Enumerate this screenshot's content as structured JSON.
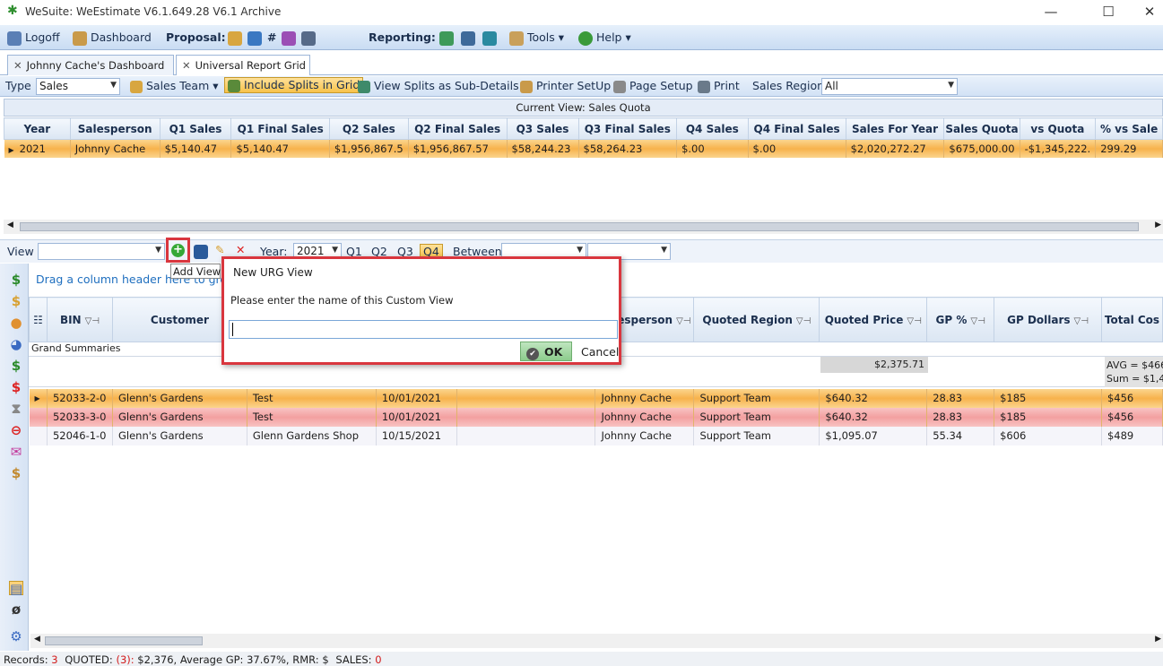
{
  "window": {
    "title": "WeSuite: WeEstimate V6.1.649.28 V6.1 Archive"
  },
  "menu": {
    "logoff": "Logoff",
    "dashboard": "Dashboard",
    "proposal": "Proposal:",
    "reporting": "Reporting:",
    "tools": "Tools",
    "help": "Help"
  },
  "tabs": [
    {
      "label": "Johnny Cache's Dashboard"
    },
    {
      "label": "Universal Report Grid"
    }
  ],
  "toolbar": {
    "type_label": "Type",
    "type_value": "Sales",
    "sales_team": "Sales Team",
    "include_splits": "Include Splits in Grid",
    "view_splits": "View Splits as Sub-Details",
    "printer_setup": "Printer SetUp",
    "page_setup": "Page Setup",
    "print": "Print",
    "sales_region_label": "Sales Region",
    "sales_region_value": "All"
  },
  "current_view": "Current View: Sales Quota",
  "quota_grid": {
    "columns": [
      "Year",
      "Salesperson",
      "Q1 Sales",
      "Q1 Final Sales",
      "Q2 Sales",
      "Q2 Final Sales",
      "Q3 Sales",
      "Q3 Final Sales",
      "Q4 Sales",
      "Q4 Final Sales",
      "Sales For Year",
      "Sales Quota",
      "vs Quota",
      "% vs Sale"
    ],
    "rows": [
      [
        "2021",
        "Johnny Cache",
        "$5,140.47",
        "$5,140.47",
        "$1,956,867.5",
        "$1,956,867.57",
        "$58,244.23",
        "$58,264.23",
        "$.00",
        "$.00",
        "$2,020,272.27",
        "$675,000.00",
        "-$1,345,222.",
        "299.29"
      ]
    ]
  },
  "viewbar": {
    "view_label": "View",
    "year_label": "Year:",
    "year_value": "2021",
    "quarters": [
      "Q1",
      "Q2",
      "Q3",
      "Q4"
    ],
    "between_label": "Between"
  },
  "tooltip": "Add View",
  "drag_hint": "Drag a column header here to group",
  "detail_grid": {
    "columns": [
      "BIN",
      "Customer",
      "",
      "",
      "",
      "Salesperson",
      "Quoted Region",
      "Quoted Price",
      "GP %",
      "GP Dollars",
      "Total Cos"
    ],
    "grand_summaries": "Grand Summaries",
    "summary_quoted_price": "$2,375.71",
    "summary_avg": "AVG = $466.",
    "summary_sum": "Sum = $1,40",
    "rows": [
      [
        "52033-2-0",
        "Glenn's Gardens",
        "Test",
        "10/01/2021",
        "",
        "Johnny Cache",
        "Support Team",
        "$640.32",
        "28.83",
        "$185",
        "$456"
      ],
      [
        "52033-3-0",
        "Glenn's Gardens",
        "Test",
        "10/01/2021",
        "",
        "Johnny Cache",
        "Support Team",
        "$640.32",
        "28.83",
        "$185",
        "$456"
      ],
      [
        "52046-1-0",
        "Glenn's Gardens",
        "Glenn Gardens Shop",
        "10/15/2021",
        "",
        "Johnny Cache",
        "Support Team",
        "$1,095.07",
        "55.34",
        "$606",
        "$489"
      ]
    ]
  },
  "dialog": {
    "title": "New URG View",
    "message": "Please enter the name of this Custom View",
    "input_value": "",
    "ok": "OK",
    "cancel": "Cancel"
  },
  "status": {
    "records_label": "Records:",
    "records_count": "3",
    "quoted_label": "QUOTED:",
    "quoted_count": "(3):",
    "quoted_text": "$2,376, Average GP: 37.67%, RMR: $",
    "sales_label": "SALES:",
    "sales_count": "0"
  },
  "colors": {
    "accent_red": "#d9363e",
    "row_orange": "#f7b24c",
    "row_pink": "#f3a0a0",
    "header_blue": "#1b2f4e"
  },
  "icons": [
    "logoff-icon",
    "dashboard-icon",
    "proposal-icons",
    "reporting-icons",
    "wrench-icon",
    "help-icon",
    "add-icon",
    "save-icon",
    "edit-icon",
    "delete-icon",
    "dollar-icon"
  ]
}
